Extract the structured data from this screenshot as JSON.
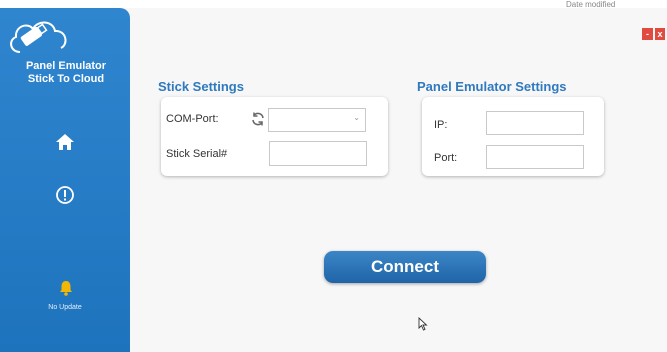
{
  "background": {
    "date_modified": "Date modified"
  },
  "sidebar": {
    "app_title_line1": "Panel Emulator",
    "app_title_line2": "Stick To Cloud",
    "update_status": "No Update"
  },
  "window": {
    "minimize": "-",
    "close": "x"
  },
  "stick_settings": {
    "title": "Stick Settings",
    "com_port_label": "COM-Port:",
    "com_port_value": "",
    "stick_serial_label": "Stick Serial#",
    "stick_serial_value": ""
  },
  "panel_settings": {
    "title": "Panel Emulator Settings",
    "ip_label": "IP:",
    "ip_value": "",
    "port_label": "Port:",
    "port_value": ""
  },
  "connect_button": "Connect",
  "colors": {
    "sidebar": "#1e73bd",
    "accent_title": "#2f79bf",
    "button": "#1f64a8",
    "close": "#e04a3f",
    "bell": "#f2b705"
  }
}
